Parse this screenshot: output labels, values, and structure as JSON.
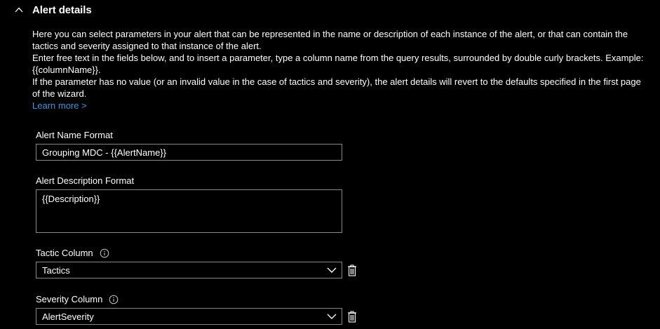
{
  "section": {
    "title": "Alert details"
  },
  "description": {
    "line1": "Here you can select parameters in your alert that can be represented in the name or description of each instance of the alert, or that can contain the tactics and severity assigned to that instance of the alert.",
    "line2": "Enter free text in the fields below, and to insert a parameter, type a column name from the query results, surrounded by double curly brackets. Example: {{columnName}}.",
    "line3": "If the parameter has no value (or an invalid value in the case of tactics and severity), the alert details will revert to the defaults specified in the first page of the wizard.",
    "learn_more": "Learn more >"
  },
  "fields": {
    "alert_name": {
      "label": "Alert Name Format",
      "value": "Grouping MDC - {{AlertName}}"
    },
    "alert_description": {
      "label": "Alert Description Format",
      "value": "{{Description}}"
    },
    "tactic": {
      "label": "Tactic Column",
      "value": "Tactics"
    },
    "severity": {
      "label": "Severity Column",
      "value": "AlertSeverity"
    }
  },
  "icons": {
    "chevron_up": "chevron-up-icon",
    "info": "info-icon",
    "chevron_down": "chevron-down-icon",
    "trash": "trash-icon"
  },
  "colors": {
    "background": "#000000",
    "text": "#ffffff",
    "link": "#3a96dd",
    "border": "#8a8886"
  }
}
